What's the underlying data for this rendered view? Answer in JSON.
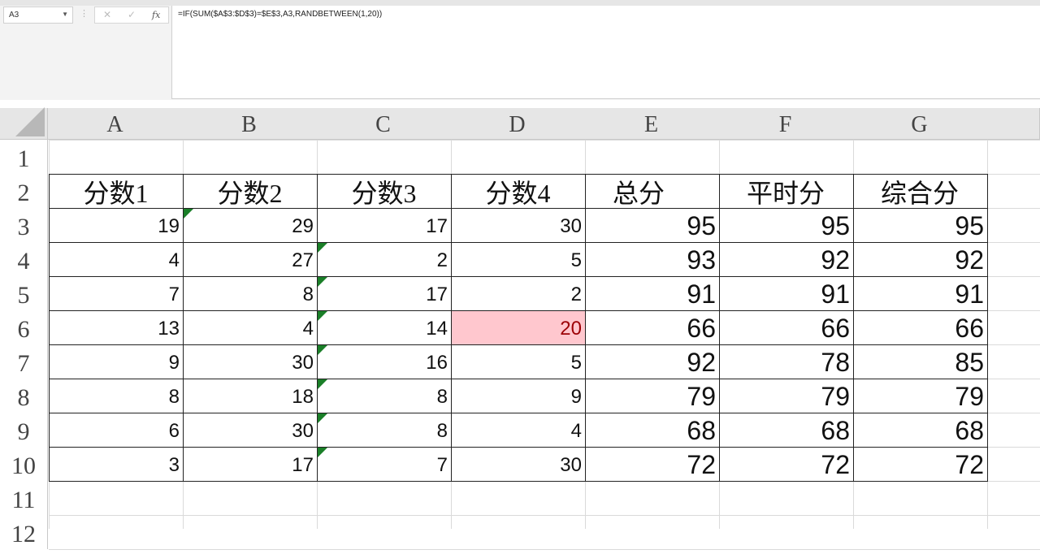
{
  "name_box": "A3",
  "formula": "=IF(SUM($A$3:$D$3)=$E$3,A3,RANDBETWEEN(1,20))",
  "formula_icons": {
    "cancel": "✕",
    "enter": "✓",
    "insert_function": "fx"
  },
  "columns": [
    "A",
    "B",
    "C",
    "D",
    "E",
    "F",
    "G"
  ],
  "rows": [
    "1",
    "2",
    "3",
    "4",
    "5",
    "6",
    "7",
    "8",
    "9",
    "10",
    "11",
    "12"
  ],
  "headers": [
    "分数1",
    "分数2",
    "分数3",
    "分数4",
    "总分",
    "平时分",
    "综合分"
  ],
  "data": [
    [
      "19",
      "29",
      "17",
      "30",
      "95",
      "95",
      "95"
    ],
    [
      "4",
      "27",
      "2",
      "5",
      "93",
      "92",
      "92"
    ],
    [
      "7",
      "8",
      "17",
      "2",
      "91",
      "91",
      "91"
    ],
    [
      "13",
      "4",
      "14",
      "20",
      "66",
      "66",
      "66"
    ],
    [
      "9",
      "30",
      "16",
      "5",
      "92",
      "78",
      "85"
    ],
    [
      "8",
      "18",
      "8",
      "9",
      "79",
      "79",
      "79"
    ],
    [
      "6",
      "30",
      "8",
      "4",
      "68",
      "68",
      "68"
    ],
    [
      "3",
      "17",
      "7",
      "30",
      "72",
      "72",
      "72"
    ]
  ],
  "highlighted_cell": {
    "row": "6",
    "column": "D",
    "fill": "#ffc7ce",
    "text_color": "#9c0006"
  },
  "error_indicator_color": "#1a7f28"
}
